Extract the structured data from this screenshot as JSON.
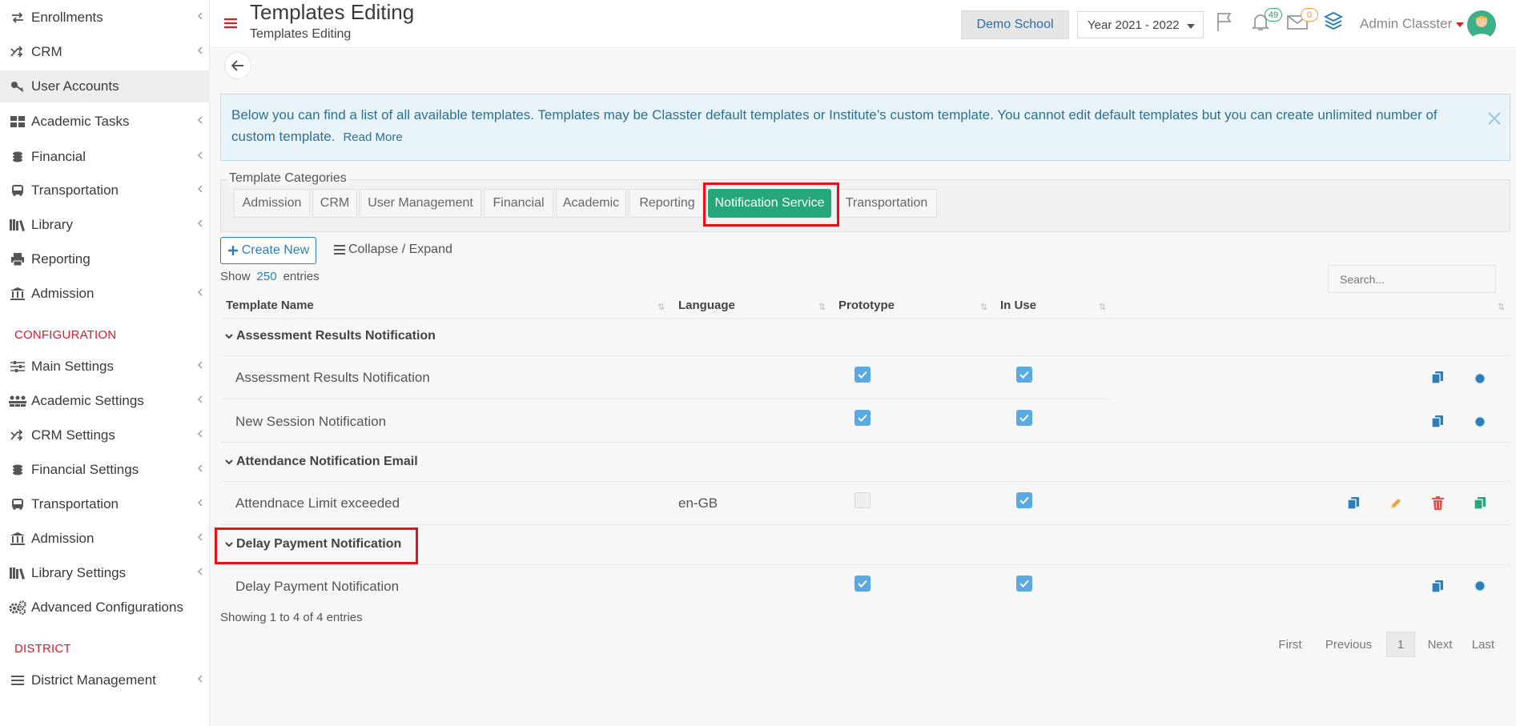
{
  "sidebar": {
    "items": [
      {
        "label": "Enrollments",
        "icon": "enrollments-arrows-icon"
      },
      {
        "label": "CRM",
        "icon": "crm-shuffle-icon"
      },
      {
        "label": "User Accounts",
        "icon": "key-icon"
      },
      {
        "label": "Academic Tasks",
        "icon": "tasks-grid-icon"
      },
      {
        "label": "Financial",
        "icon": "coins-icon"
      },
      {
        "label": "Transportation",
        "icon": "bus-icon"
      },
      {
        "label": "Library",
        "icon": "books-icon"
      },
      {
        "label": "Reporting",
        "icon": "printer-icon"
      },
      {
        "label": "Admission",
        "icon": "institution-icon"
      }
    ],
    "config_title": "CONFIGURATION",
    "config_items": [
      {
        "label": "Main Settings",
        "icon": "sliders-icon"
      },
      {
        "label": "Academic Settings",
        "icon": "users-group-icon"
      },
      {
        "label": "CRM Settings",
        "icon": "crm-shuffle-icon"
      },
      {
        "label": "Financial Settings",
        "icon": "coins-icon"
      },
      {
        "label": "Transportation",
        "icon": "bus-icon"
      },
      {
        "label": "Admission",
        "icon": "institution-icon"
      },
      {
        "label": "Library Settings",
        "icon": "books-icon"
      },
      {
        "label": "Advanced Configurations",
        "icon": "gears-icon"
      }
    ],
    "district_title": "DISTRICT",
    "district_items": [
      {
        "label": "District Management",
        "icon": "list-icon"
      }
    ]
  },
  "header": {
    "title": "Templates Editing",
    "subtitle": "Templates Editing",
    "school": "Demo School",
    "year": "Year 2021 - 2022",
    "notifications_count": "49",
    "messages_count": "0",
    "user_name": "Admin Classter"
  },
  "info": {
    "text": "Below you can find a list of all available templates. Templates may be Classter default templates or Institute’s custom template. You cannot edit default templates but you can create unlimited number of custom template.",
    "read_more": "Read More"
  },
  "categories": {
    "title": "Template Categories",
    "items": [
      "Admission",
      "CRM",
      "User Management",
      "Financial",
      "Academic",
      "Reporting",
      "Notification Service",
      "Transportation"
    ],
    "active": "Notification Service"
  },
  "toolbar": {
    "create_new": "Create New",
    "collapse_expand": "Collapse / Expand",
    "show_label": "Show",
    "show_count": "250",
    "entries_label": "entries",
    "search_placeholder": "Search..."
  },
  "table": {
    "columns": [
      "Template Name",
      "Language",
      "Prototype",
      "In Use"
    ],
    "groups": [
      {
        "name": "Assessment Results Notification",
        "rows": [
          {
            "name": "Assessment Results Notification",
            "language": "",
            "prototype": true,
            "in_use": true
          },
          {
            "name": "New Session Notification",
            "language": "",
            "prototype": true,
            "in_use": true
          }
        ]
      },
      {
        "name": "Attendance Notification Email",
        "rows": [
          {
            "name": "Attendnace Limit exceeded",
            "language": "en-GB",
            "prototype": false,
            "in_use": true
          }
        ]
      },
      {
        "name": "Delay Payment Notification",
        "rows": [
          {
            "name": "Delay Payment Notification",
            "language": "",
            "prototype": true,
            "in_use": true
          }
        ]
      }
    ]
  },
  "footer": {
    "showing": "Showing 1 to 4 of 4 entries",
    "pagination": {
      "first": "First",
      "previous": "Previous",
      "current": "1",
      "next": "Next",
      "last": "Last"
    }
  },
  "colors": {
    "accent_green": "#26a77b",
    "brand_red": "#d0202a",
    "link_blue": "#2e7fb8",
    "highlight_red": "#e8101a"
  }
}
